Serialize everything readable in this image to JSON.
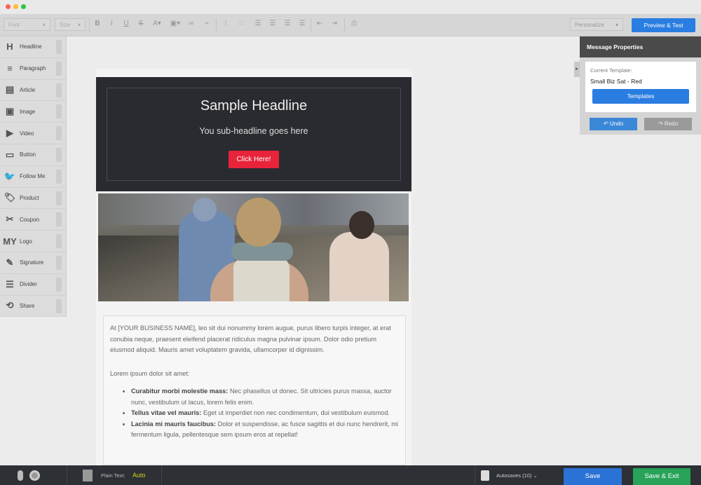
{
  "window": {
    "colors": {
      "close": "#ff5f57",
      "min": "#febc2e",
      "max": "#28c840"
    }
  },
  "toolbar": {
    "font_label": "Font",
    "size_label": "Size",
    "personalize_label": "Personalize",
    "preview_label": "Preview & Test"
  },
  "sidebar": {
    "items": [
      {
        "label": "Headline",
        "icon": "H"
      },
      {
        "label": "Paragraph",
        "icon": "≡"
      },
      {
        "label": "Article",
        "icon": "▤"
      },
      {
        "label": "Image",
        "icon": "▣"
      },
      {
        "label": "Video",
        "icon": "▶"
      },
      {
        "label": "Button",
        "icon": "▭"
      },
      {
        "label": "Follow Me",
        "icon": "🐦"
      },
      {
        "label": "Product",
        "icon": "🏷"
      },
      {
        "label": "Coupon",
        "icon": "✂"
      },
      {
        "label": "Logo",
        "icon": "MY"
      },
      {
        "label": "Signature",
        "icon": "✎"
      },
      {
        "label": "Divider",
        "icon": "☰"
      },
      {
        "label": "Share",
        "icon": "⟲"
      }
    ]
  },
  "email": {
    "headline": "Sample Headline",
    "subheadline": "You sub-headline goes here",
    "cta": "Click Here!",
    "intro": "At [YOUR BUSINESS NAME], leo sit dui nonummy lorem augue, purus libero turpis integer, at erat conubia neque, praesent eleifend placerat ridiculus magna pulvinar ipsum. Dolor odio pretium eiusmod aliquid. Mauris amet voluptatem gravida, ullamcorper id dignissim.",
    "lead": "Lorem ipsum dolor sit amet:",
    "bullets": [
      {
        "title": "Curabitur morbi molestie mass:",
        "text": "Nec phasellus ut donec. Sit ultricies purus massa, auctor nunc, vestibulum ut lacus, lorem felis enim."
      },
      {
        "title": "Tellus vitae vel mauris:",
        "text": "Eget ut imperdiet non nec condimentum, dui vestibulum euismod."
      },
      {
        "title": "Lacinia mi mauris faucibus:",
        "text": "Dolor et suspendisse, ac fusce sagittis et dui nunc hendrerit, mi fermentum ligula, pellentesque sem ipsum eros at repellat!"
      }
    ]
  },
  "panel": {
    "title": "Message Properties",
    "current_template_label": "Current Template:",
    "current_template": "Small Biz Sat - Red",
    "templates_button": "Templates",
    "undo": "Undo",
    "redo": "Redo"
  },
  "bottom": {
    "plain_text_label": "Plain Text:",
    "plain_text_value": "Auto",
    "autosaves": "Autosaves (10)",
    "save": "Save",
    "save_exit": "Save & Exit"
  }
}
